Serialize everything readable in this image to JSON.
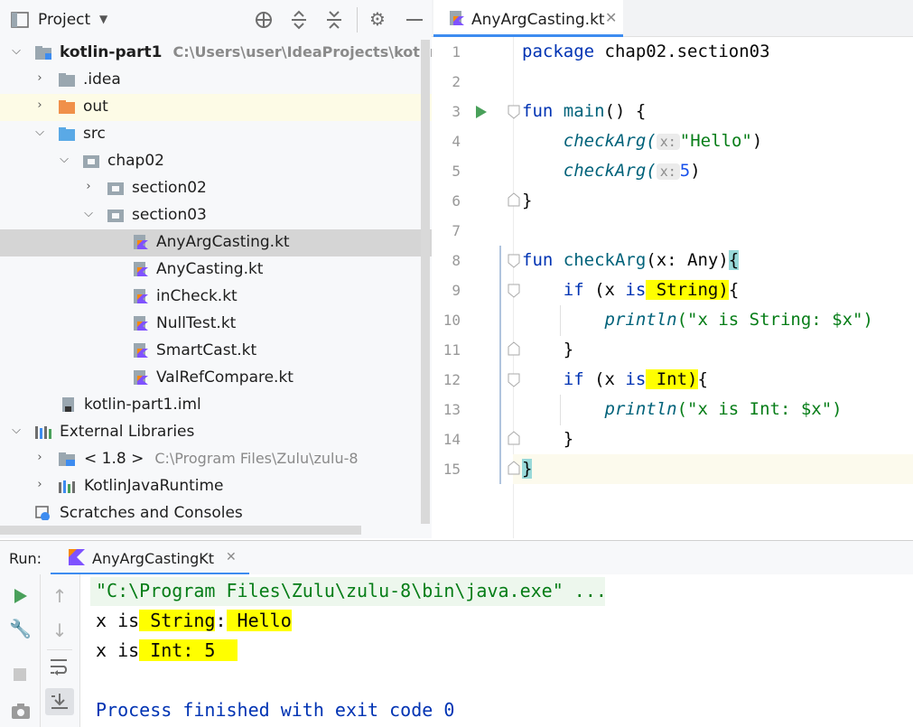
{
  "project": {
    "title": "Project",
    "tree": [
      {
        "label": "kotlin-part1",
        "path": "C:\\Users\\user\\IdeaProjects\\kotlin-",
        "depth": 0,
        "expanded": true,
        "icon": "module-folder-icon"
      },
      {
        "label": ".idea",
        "depth": 1,
        "expanded": false,
        "icon": "folder-icon"
      },
      {
        "label": "out",
        "depth": 1,
        "expanded": false,
        "icon": "excluded-folder-icon"
      },
      {
        "label": "src",
        "depth": 1,
        "expanded": true,
        "icon": "source-folder-icon"
      },
      {
        "label": "chap02",
        "depth": 2,
        "expanded": true,
        "icon": "package-icon"
      },
      {
        "label": "section02",
        "depth": 3,
        "expanded": false,
        "icon": "package-icon"
      },
      {
        "label": "section03",
        "depth": 3,
        "expanded": true,
        "icon": "package-icon"
      },
      {
        "label": "AnyArgCasting.kt",
        "depth": 4,
        "icon": "kotlin-file-icon"
      },
      {
        "label": "AnyCasting.kt",
        "depth": 4,
        "icon": "kotlin-file-icon"
      },
      {
        "label": "inCheck.kt",
        "depth": 4,
        "icon": "kotlin-file-icon"
      },
      {
        "label": "NullTest.kt",
        "depth": 4,
        "icon": "kotlin-file-icon"
      },
      {
        "label": "SmartCast.kt",
        "depth": 4,
        "icon": "kotlin-file-icon"
      },
      {
        "label": "ValRefCompare.kt",
        "depth": 4,
        "icon": "kotlin-file-icon"
      },
      {
        "label": "kotlin-part1.iml",
        "depth": 1,
        "icon": "iml-file-icon"
      },
      {
        "label": "External Libraries",
        "depth": 0,
        "expanded": true,
        "icon": "libraries-icon"
      },
      {
        "label": "< 1.8 >",
        "path": "C:\\Program Files\\Zulu\\zulu-8",
        "depth": 1,
        "expanded": false,
        "icon": "jdk-icon"
      },
      {
        "label": "KotlinJavaRuntime",
        "depth": 1,
        "expanded": false,
        "icon": "library-icon"
      },
      {
        "label": "Scratches and Consoles",
        "depth": 0,
        "icon": "scratches-icon"
      }
    ]
  },
  "editor": {
    "tab_label": "AnyArgCasting.kt",
    "line_numbers": [
      "1",
      "2",
      "3",
      "4",
      "5",
      "6",
      "7",
      "8",
      "9",
      "10",
      "11",
      "12",
      "13",
      "14",
      "15"
    ],
    "code": {
      "l1_kw": "package",
      "l1_rest": " chap02.section03",
      "l3_kw": "fun",
      "l3_fn": " main",
      "l3_rest": "() {",
      "l4_call": "    checkArg(",
      "l4_hint": "x:",
      "l4_arg": "\"Hello\"",
      "l4_end": ")",
      "l5_call": "    checkArg(",
      "l5_hint": "x:",
      "l5_arg": "5",
      "l5_end": ")",
      "l6": "}",
      "l8_kw": "fun",
      "l8_fn": " checkArg",
      "l8_rest": "(x: Any)",
      "l8_brace": "{",
      "l9_kw": "    if",
      "l9_mid": " (x ",
      "l9_is": "is",
      "l9_type": " String)",
      "l9_end": "{",
      "l10_call": "        println",
      "l10_str": "(\"x is String: $x\")",
      "l11": "    }",
      "l12_kw": "    if",
      "l12_mid": " (x ",
      "l12_is": "is",
      "l12_type": " Int)",
      "l12_end": "{",
      "l13_call": "        println",
      "l13_str": "(\"x is Int: $x\")",
      "l14": "    }",
      "l15": "}"
    }
  },
  "run": {
    "label": "Run:",
    "tab_label": "AnyArgCastingKt",
    "console": {
      "cmd": "\"C:\\Program Files\\Zulu\\zulu-8\\bin\\java.exe\" ...",
      "out1_a": "x is",
      "out1_b": " String",
      "out1_c": ":",
      "out1_d": " Hello",
      "out2_a": "x is",
      "out2_b": " Int",
      "out2_c": ":",
      "out2_d": " 5  ",
      "exit": "Process finished with exit code 0"
    }
  },
  "colors": {
    "accent": "#3d8cf0",
    "keyword": "#0033b3",
    "string": "#067d17",
    "highlight": "#ffff00"
  }
}
